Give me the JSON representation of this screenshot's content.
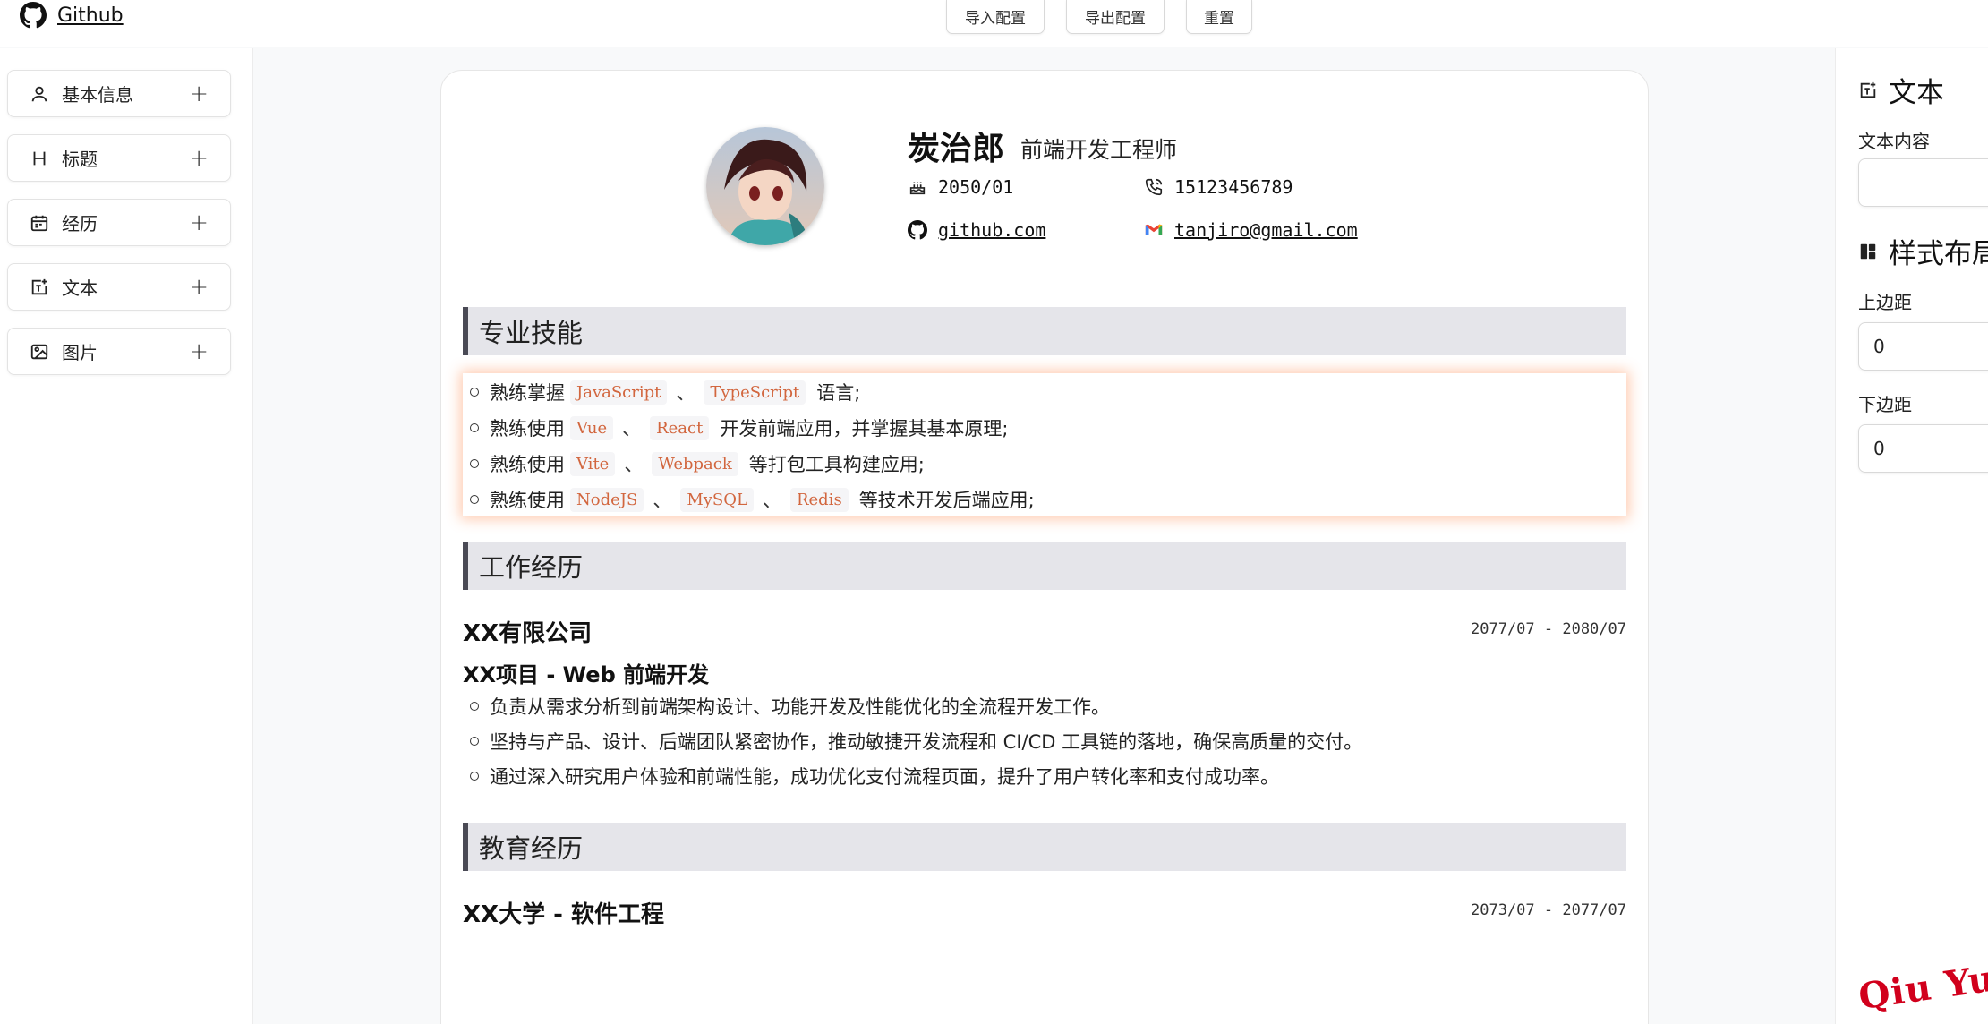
{
  "topbar": {
    "github_label": "Github",
    "import_label": "导入配置",
    "export_label": "导出配置",
    "reset_label": "重置"
  },
  "sidebar": {
    "items": [
      {
        "label": "基本信息",
        "icon": "user-icon"
      },
      {
        "label": "标题",
        "icon": "heading-icon"
      },
      {
        "label": "经历",
        "icon": "calendar-icon"
      },
      {
        "label": "文本",
        "icon": "text-add-icon"
      },
      {
        "label": "图片",
        "icon": "image-icon"
      }
    ],
    "plus": "+"
  },
  "resume": {
    "name": "炭治郎",
    "job": "前端开发工程师",
    "birthday": "2050/01",
    "phone": "15123456789",
    "github": "github.com",
    "email": "tanjiro@gmail.com",
    "sections": {
      "skills": "专业技能",
      "work": "工作经历",
      "education": "教育经历"
    },
    "skills": [
      {
        "prefix": "熟练掌握",
        "tags": [
          "JavaScript",
          "TypeScript"
        ],
        "suffix": "语言;"
      },
      {
        "prefix": "熟练使用",
        "tags": [
          "Vue",
          "React"
        ],
        "suffix": "开发前端应用，并掌握其基本原理;"
      },
      {
        "prefix": "熟练使用",
        "tags": [
          "Vite",
          "Webpack"
        ],
        "suffix": "等打包工具构建应用;"
      },
      {
        "prefix": "熟练使用",
        "tags": [
          "NodeJS",
          "MySQL",
          "Redis"
        ],
        "suffix": "等技术开发后端应用;"
      }
    ],
    "separator": "、",
    "work": {
      "company": "XX有限公司",
      "date": "2077/07 - 2080/07",
      "project": "XX项目 - Web 前端开发",
      "items": [
        "负责从需求分析到前端架构设计、功能开发及性能优化的全流程开发工作。",
        "坚持与产品、设计、后端团队紧密协作，推动敏捷开发流程和 CI/CD 工具链的落地，确保高质量的交付。",
        "通过深入研究用户体验和前端性能，成功优化支付流程页面，提升了用户转化率和支付成功率。"
      ]
    },
    "education": {
      "school": "XX大学 - 软件工程",
      "date": "2073/07 - 2077/07"
    }
  },
  "panel": {
    "text_title": "文本",
    "text_content_label": "文本内容",
    "text_content_value": "",
    "layout_title": "样式布局",
    "top_margin_label": "上边距",
    "top_margin_value": "0",
    "bottom_margin_label": "下边距",
    "bottom_margin_value": "0"
  },
  "watermark": "Qiu Yue"
}
